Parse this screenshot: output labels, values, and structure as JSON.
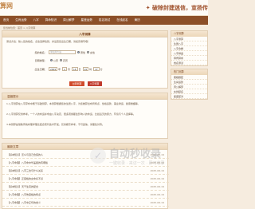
{
  "header": {
    "logo": "算网",
    "slogan": "✦ 破除封建迷信，宣扬传"
  },
  "nav": {
    "items": [
      "首页",
      "生肖运势",
      "八字",
      "算命知识",
      "周公解梦",
      "星座运势",
      "姓名测试",
      "在线起名",
      "黄历"
    ]
  },
  "breadcrumb": "您当前位置：首页 > 八字测算",
  "calc": {
    "title": "八字测算",
    "desc": "测试方法：输入您的姓名，点击选择性别，并设置您出生日期，请如实填写哦！",
    "name_label": "您的姓名：",
    "name_placeholder": "李如风大运",
    "gender_male": "男性",
    "gender_female": "女性",
    "date_type_label": "日期类型：",
    "date_solar": "公历",
    "date_lunar": "农历",
    "birth_label": "出生日期：",
    "year": "2009",
    "year_unit": "年",
    "month": "2",
    "month_unit": "月",
    "day": "16",
    "day_unit": "日",
    "hour": "19",
    "hour_unit": "时",
    "minute": "37",
    "minute_unit": "分",
    "submit_label": "立即测算",
    "reset_label": "八字测算"
  },
  "tips": {
    "title": "温馨提示",
    "lines": [
      "1.八字测算在八字算命中属于基础测算，本测算根据您的生辰八字，为您推算出命局特点、性格运势、事业财运、健康婚姻等，",
      "2.八字测算仅供参考。一个人的命运并非由八字决定，很多因素都会影响人的命运，比如后天的努力、环境与个人选择等。",
      "3.本测算是借助传统命理学理论结合现代技术开发，仅供娱乐参考，不可迷信，请理性对待。"
    ]
  },
  "articles": {
    "title": "最新文章",
    "items": [
      {
        "text": "【基本知识】怎么与自己合契的人",
        "date": "2025-06-19"
      },
      {
        "text": "【八字命理】八字命中华盖星的有哪些",
        "date": "2025-06-19"
      },
      {
        "text": "【基本知识】八字三合与什么关系",
        "date": "2025-06-19"
      },
      {
        "text": "【八字命理】正官格的女命好不好",
        "date": "2025-06-19"
      },
      {
        "text": "【基本知识】天干生克的配合",
        "date": "2025-06-19"
      },
      {
        "text": "【八字命理】八字伤官格的特点",
        "date": "2025-06-19"
      },
      {
        "text": "【八字命理】八字中正印的含义",
        "date": "2025-06-19"
      }
    ]
  },
  "side": {
    "box1_title": "八字测算",
    "box1_links": [
      "八字测算",
      "生辰八字",
      "八字合婚",
      "八字排盘",
      "称骨算命",
      "姓名测试"
    ],
    "box2_title": "热门测算",
    "box2_links": [
      "属相婚配",
      "生肖运势",
      "周公解梦",
      "在线起名",
      "星座配对"
    ]
  },
  "watermark": {
    "title": "自动秒收录",
    "sub": "一键收录 · 来访一次 · 即可收录"
  }
}
